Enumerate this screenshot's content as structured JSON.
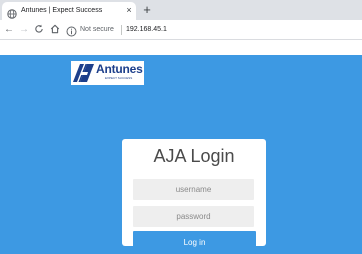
{
  "browser": {
    "tab": {
      "title": "Antunes | Expect Success",
      "close_glyph": "×",
      "favicon": "globe-icon"
    },
    "new_tab_glyph": "+",
    "nav": {
      "back_glyph": "←",
      "forward_glyph": "→",
      "reload_glyph": "C",
      "home_glyph": "⌂"
    },
    "omnibox": {
      "security_text": "Not secure",
      "url": "192.168.45.1",
      "info_icon": "info-icon"
    }
  },
  "page": {
    "background_color": "#3d99e3",
    "logo": {
      "name": "Antunes",
      "tagline": "EXPECT SUCCESS"
    },
    "login": {
      "title": "AJA Login",
      "username_placeholder": "username",
      "password_placeholder": "password",
      "button_label": "Log in",
      "button_color": "#3d99e3"
    }
  }
}
